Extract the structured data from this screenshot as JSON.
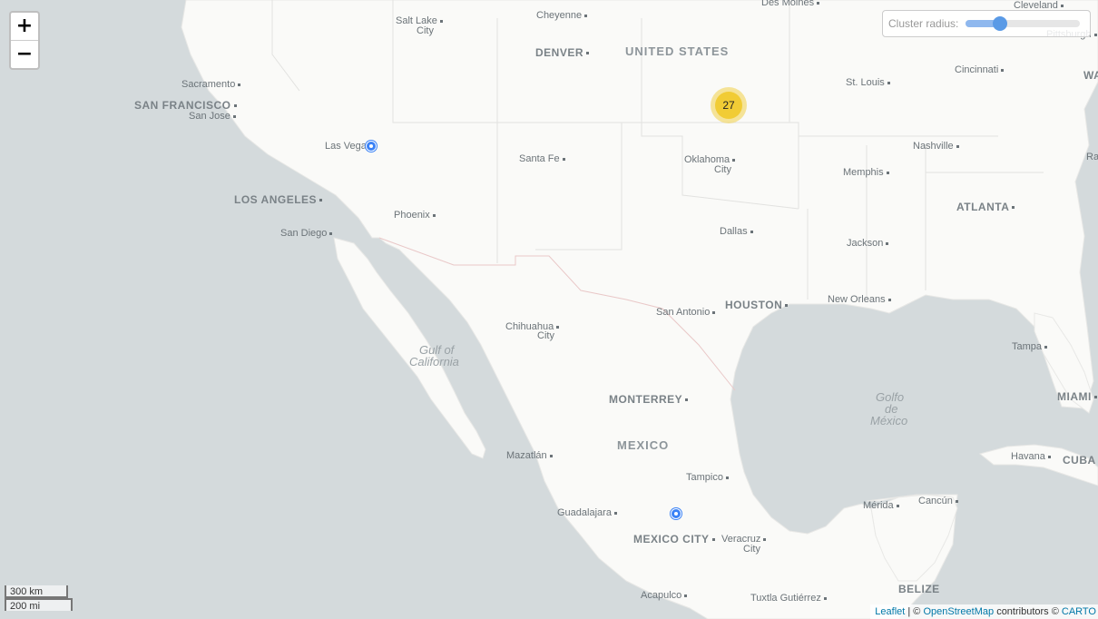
{
  "controls": {
    "zoom_in": "+",
    "zoom_out": "−",
    "radius_label": "Cluster radius:",
    "radius_value_fraction": 0.3
  },
  "cluster": {
    "count": "27"
  },
  "markers": [
    {
      "name": "marker-las-vegas",
      "icon": "map-pin-icon"
    },
    {
      "name": "marker-central-mexico",
      "icon": "map-pin-icon"
    }
  ],
  "labels": {
    "salt_lake_city_1": "Salt Lake",
    "salt_lake_city_2": "City",
    "cheyenne": "Cheyenne",
    "des_moines": "Des Moines",
    "cleveland": "Cleveland",
    "pittsburgh": "Pittsburgh",
    "denver": "DENVER",
    "united_states": "UNITED STATES",
    "sacramento": "Sacramento",
    "cincinnati": "Cincinnati",
    "wa": "WA",
    "st_louis": "St. Louis",
    "san_francisco": "SAN FRANCISCO",
    "san_jose": "San Jose",
    "las_vegas": "Las Vegas",
    "nashville": "Nashville",
    "santa_fe": "Santa Fe",
    "oklahoma_city_1": "Oklahoma",
    "oklahoma_city_2": "City",
    "ra": "Ra",
    "memphis": "Memphis",
    "los_angeles": "LOS ANGELES",
    "atlanta": "ATLANTA",
    "phoenix": "Phoenix",
    "san_diego": "San Diego",
    "dallas": "Dallas",
    "jackson": "Jackson",
    "houston": "HOUSTON",
    "new_orleans": "New Orleans",
    "san_antonio": "San Antonio",
    "chihuahua_city_1": "Chihuahua",
    "chihuahua_city_2": "City",
    "tampa": "Tampa",
    "gulf_of_california_1": "Gulf of",
    "gulf_of_california_2": "California",
    "golfo_de_mexico_1": "Golfo",
    "golfo_de_mexico_2": "de",
    "golfo_de_mexico_3": "México",
    "miami": "MIAMI",
    "monterrey": "MONTERREY",
    "mexico": "MEXICO",
    "mazatlan": "Mazatlán",
    "havana": "Havana",
    "cuba": "CUBA",
    "tampico": "Tampico",
    "merida": "Mérida",
    "cancun": "Cancún",
    "guadalajara": "Guadalajara",
    "mexico_city": "MEXICO CITY",
    "veracruz_1": "Veracruz",
    "veracruz_2": "City",
    "belize": "BELIZE",
    "acapulco": "Acapulco",
    "tuxtla_gutierrez": "Tuxtla Gutiérrez"
  },
  "scale": {
    "km": "300 km",
    "mi": "200 mi"
  },
  "attribution": {
    "leaflet": "Leaflet",
    "sep": "| ©",
    "osm": "OpenStreetMap",
    "contributors": "contributors ©",
    "carto": "CARTO"
  },
  "colors": {
    "water": "#d4dadc",
    "land": "#fafaf8",
    "cluster_outer": "#f1d357",
    "cluster_inner": "#f0c20c",
    "marker": "#3b82f6",
    "link": "#0078a8"
  }
}
